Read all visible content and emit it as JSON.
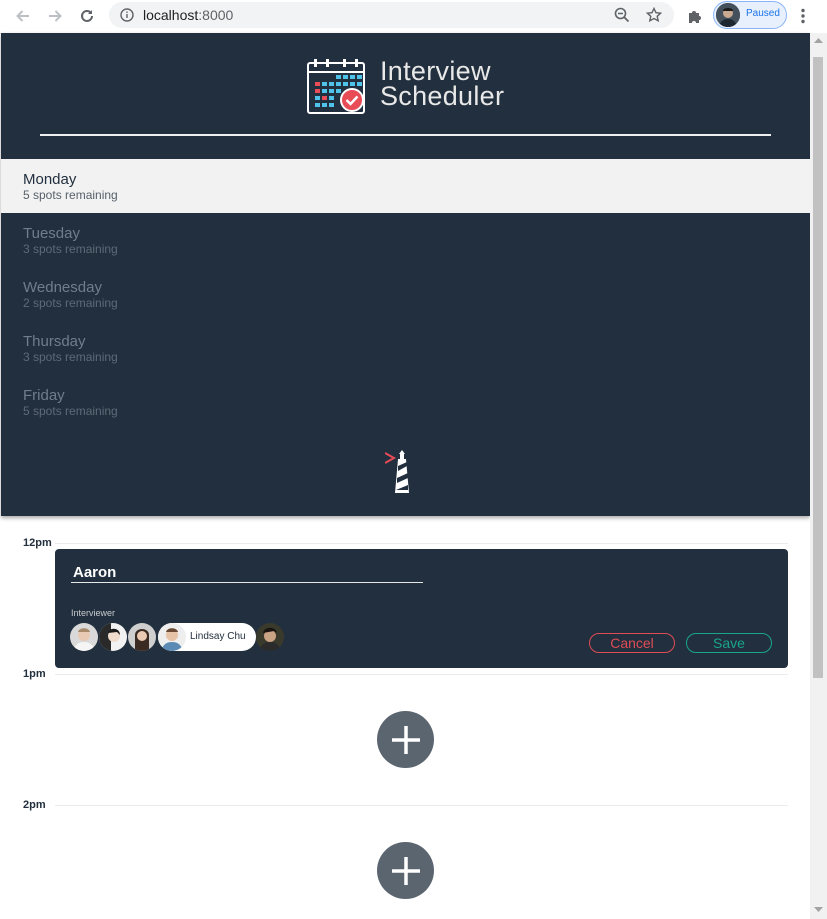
{
  "browser": {
    "url_host": "localhost",
    "url_port": ":8000",
    "profile_status": "Paused"
  },
  "app": {
    "title_line1": "Interview",
    "title_line2": "Scheduler"
  },
  "days": [
    {
      "name": "Monday",
      "spots": "5 spots remaining",
      "selected": true
    },
    {
      "name": "Tuesday",
      "spots": "3 spots remaining",
      "selected": false
    },
    {
      "name": "Wednesday",
      "spots": "2 spots remaining",
      "selected": false
    },
    {
      "name": "Thursday",
      "spots": "3 spots remaining",
      "selected": false
    },
    {
      "name": "Friday",
      "spots": "5 spots remaining",
      "selected": false
    }
  ],
  "schedule": {
    "slots": [
      "12pm",
      "1pm",
      "2pm"
    ],
    "form": {
      "student_name": "Aaron",
      "interviewer_label": "Interviewer",
      "selected_interviewer": "Lindsay Chu",
      "cancel_label": "Cancel",
      "save_label": "Save"
    }
  },
  "colors": {
    "sidebar": "#222f3e",
    "danger": "#df4c55",
    "success": "#1aa58a"
  }
}
